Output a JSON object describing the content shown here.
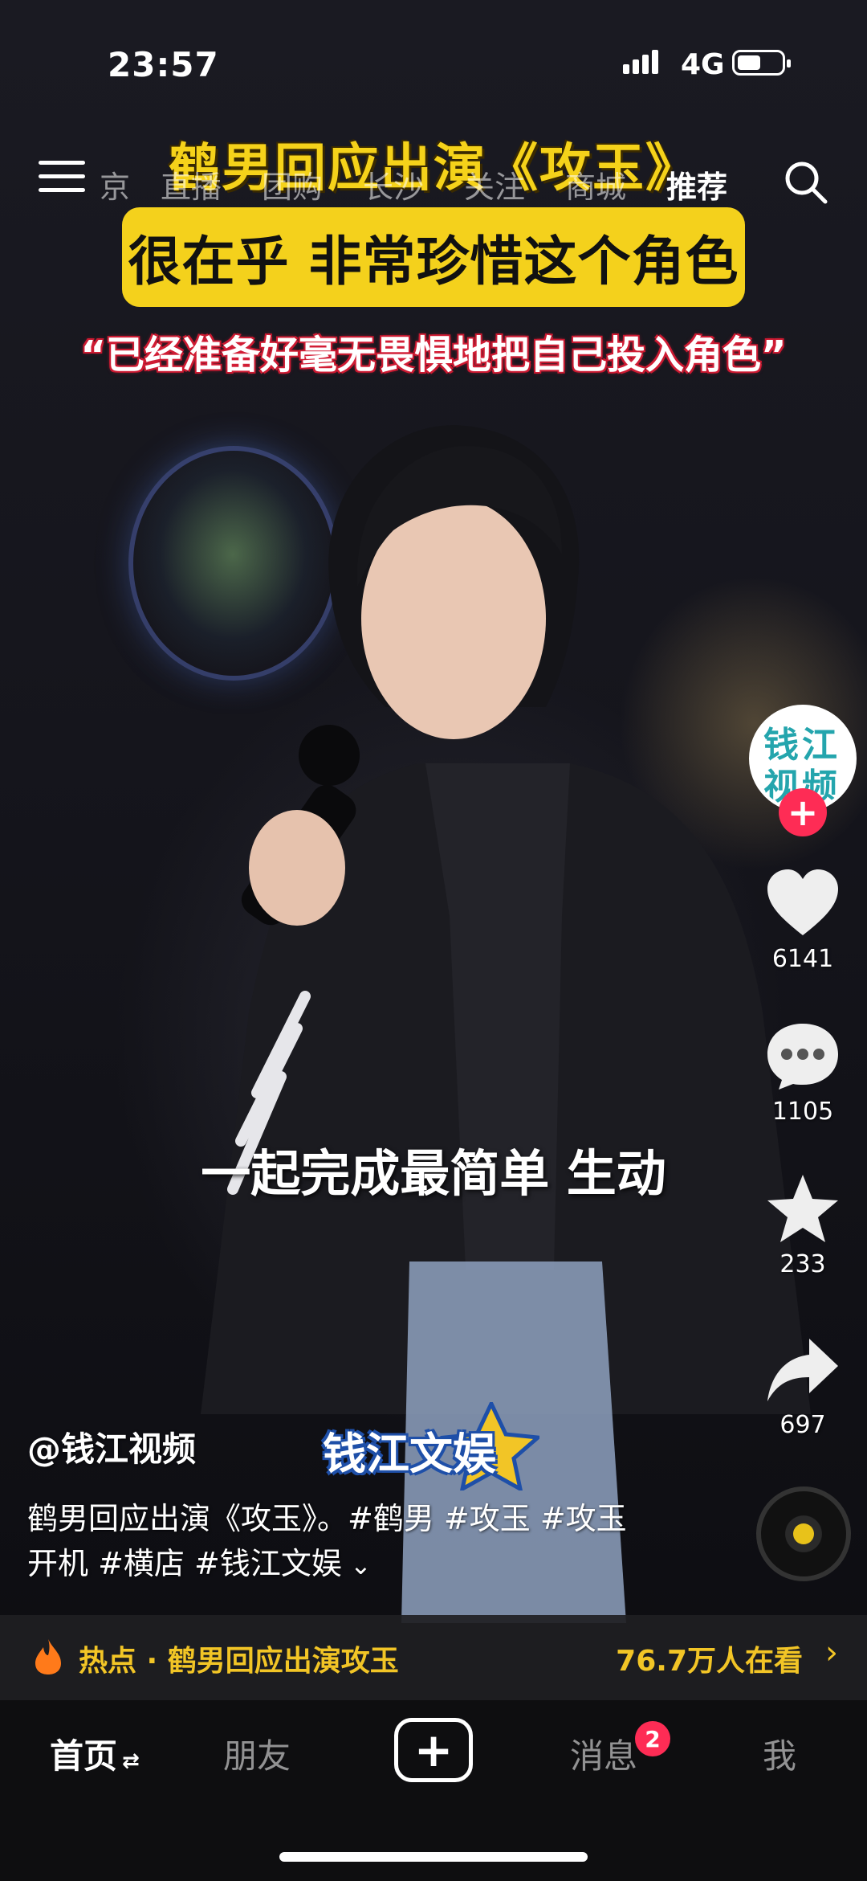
{
  "status_bar": {
    "time": "23:57",
    "network": "4G"
  },
  "top_nav": {
    "tabs": [
      {
        "label": "京",
        "active": false
      },
      {
        "label": "直播",
        "active": false
      },
      {
        "label": "团购",
        "active": false
      },
      {
        "label": "长沙",
        "active": false
      },
      {
        "label": "关注",
        "active": false
      },
      {
        "label": "商城",
        "active": false
      },
      {
        "label": "推荐",
        "active": true
      }
    ]
  },
  "video": {
    "headline": "鹤男回应出演《攻玉》",
    "banner": "很在乎 非常珍惜这个角色",
    "quote": "“已经准备好毫无畏惧地把自己投入角色”",
    "subtitle": "一起完成最简单 生动",
    "watermark": "钱江文娱",
    "author": "@钱江视频",
    "description_line1": "鹤男回应出演《攻玉》。#鹤男 #攻玉 #攻玉",
    "description_line2": "开机 #横店 #钱江文娱",
    "avatar_text": [
      "钱",
      "江",
      "视",
      "频"
    ]
  },
  "actions": {
    "likes": "6141",
    "comments": "1105",
    "favorites": "233",
    "shares": "697"
  },
  "hot_bar": {
    "label": "热点 · 鹤男回应出演攻玉",
    "viewers": "76.7万人在看"
  },
  "bottom_nav": {
    "home": "首页",
    "friends": "朋友",
    "messages": "消息",
    "messages_badge": "2",
    "me": "我"
  },
  "colors": {
    "accent_yellow": "#f4d11c",
    "brand_red": "#fe2c55",
    "hot_gold": "#f2c526"
  }
}
